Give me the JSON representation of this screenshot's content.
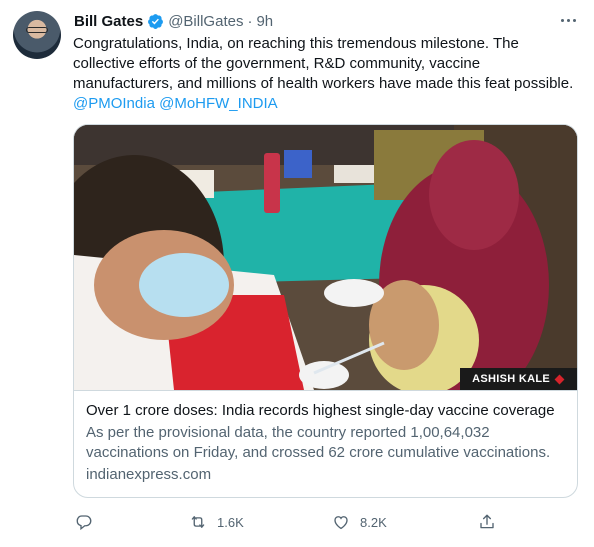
{
  "tweet": {
    "name": "Bill Gates",
    "handle": "@BillGates",
    "separator": "·",
    "time": "9h",
    "text_line1": "Congratulations, India, on reaching this tremendous milestone. The",
    "text_line2": "collective efforts of the government, R&D community, vaccine",
    "text_line3": "manufacturers, and millions of health workers have made this feat possible.",
    "mention1": "@PMOIndia",
    "mention2": "@MoHFW_INDIA"
  },
  "card": {
    "photo_credit": "ASHISH KALE",
    "title": "Over 1 crore doses: India records highest single-day vaccine coverage",
    "description_line1": "As per the provisional data, the country reported 1,00,64,032",
    "description_line2": "vaccinations on Friday, and crossed 62 crore cumulative vaccinations.",
    "domain": "indianexpress.com"
  },
  "actions": {
    "reply_count": "",
    "retweet_count": "1.6K",
    "like_count": "8.2K"
  },
  "colors": {
    "accent": "#1d9bf0",
    "secondary_text": "#536471",
    "border": "#cfd9de"
  },
  "icons": [
    "verified-badge-icon",
    "more-options-icon",
    "reply-icon",
    "retweet-icon",
    "like-icon",
    "share-icon"
  ]
}
